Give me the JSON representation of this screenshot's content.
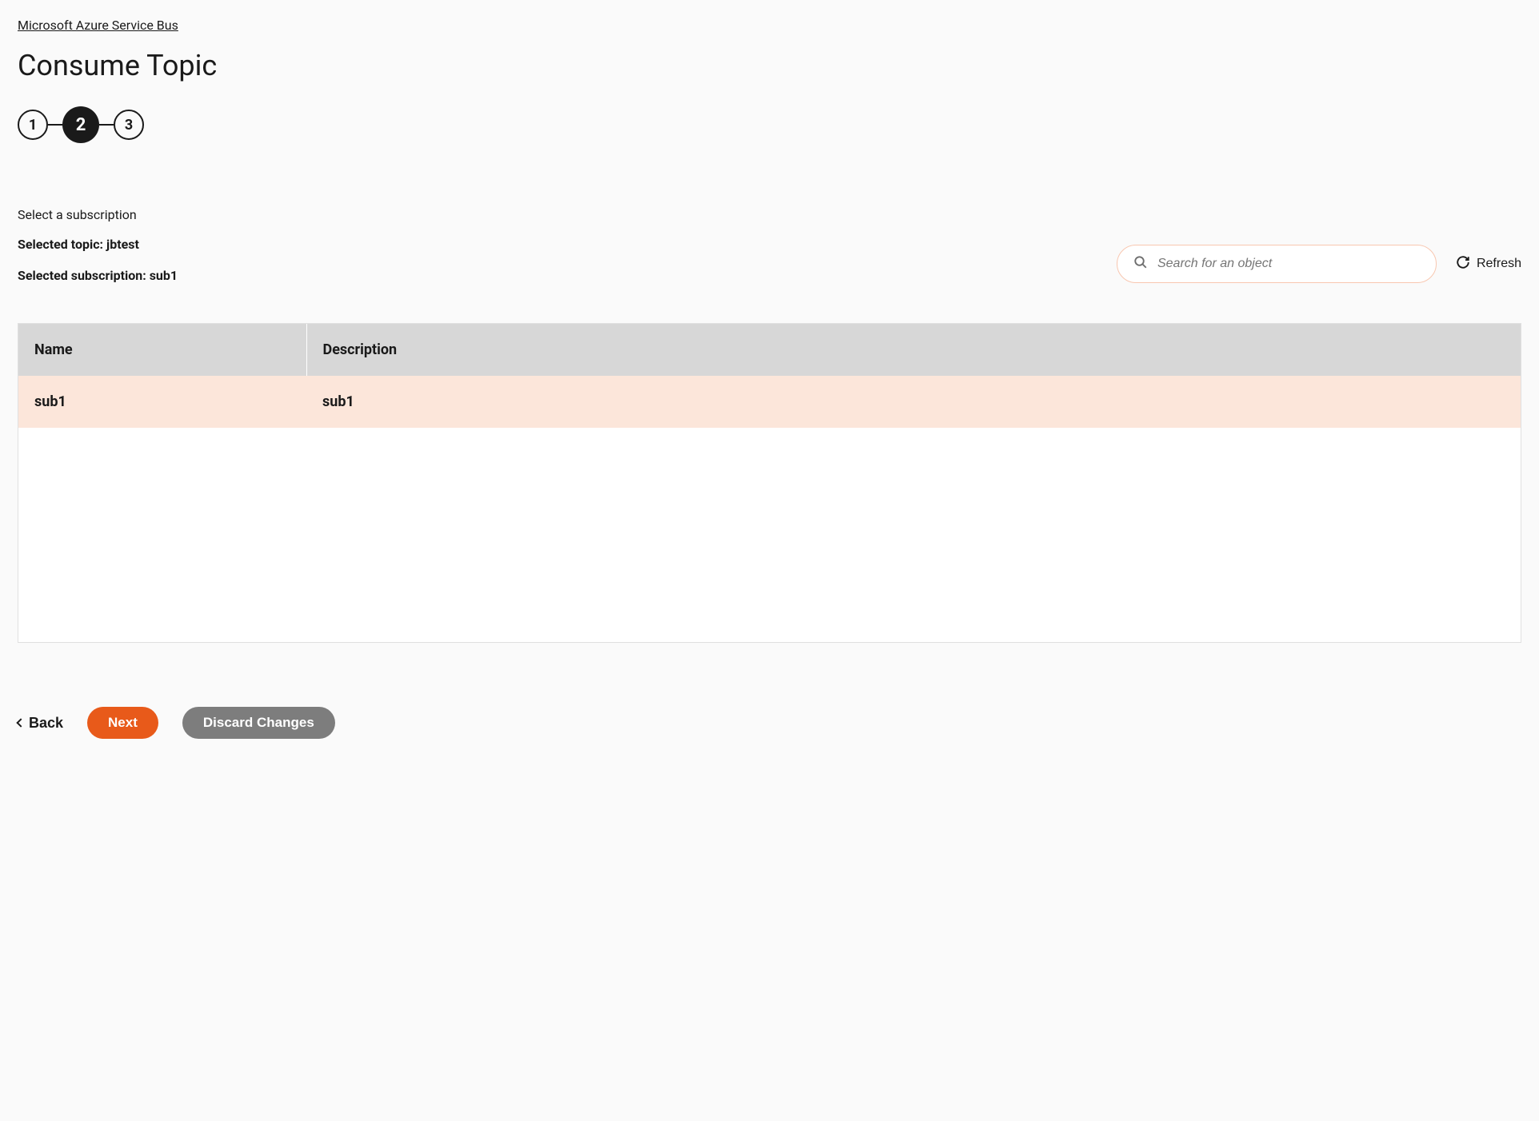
{
  "breadcrumb": "Microsoft Azure Service Bus",
  "page_title": "Consume Topic",
  "stepper": {
    "steps": [
      "1",
      "2",
      "3"
    ],
    "active_index": 1
  },
  "instruction": "Select a subscription",
  "selected_topic_label": "Selected topic: jbtest",
  "selected_subscription_label": "Selected subscription: sub1",
  "search": {
    "placeholder": "Search for an object"
  },
  "refresh_label": "Refresh",
  "table": {
    "headers": {
      "name": "Name",
      "description": "Description"
    },
    "rows": [
      {
        "name": "sub1",
        "description": "sub1",
        "selected": true
      }
    ]
  },
  "buttons": {
    "back": "Back",
    "next": "Next",
    "discard": "Discard Changes"
  }
}
